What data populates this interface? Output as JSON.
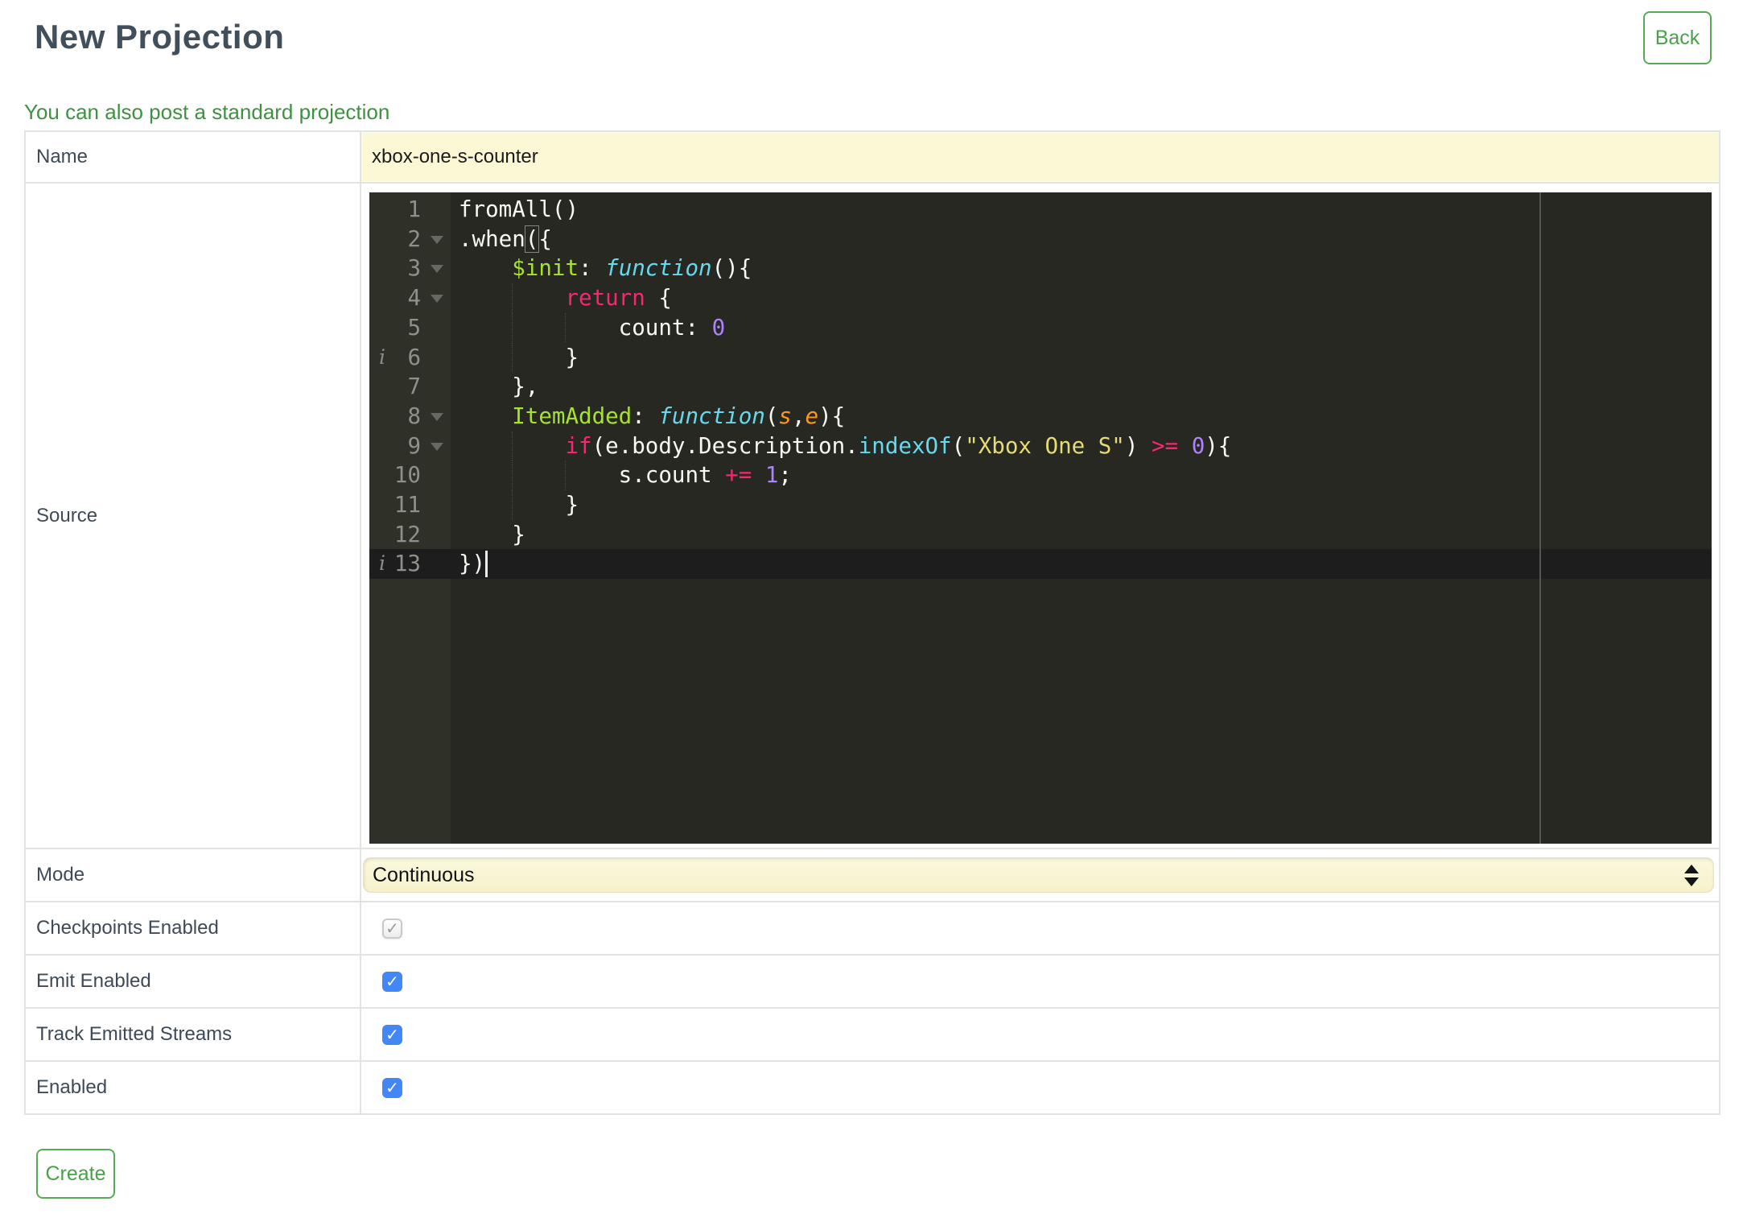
{
  "page": {
    "title": "New Projection"
  },
  "toolbar": {
    "back_label": "Back",
    "create_label": "Create"
  },
  "link": {
    "standard_projection": "You can also post a standard projection"
  },
  "icons": {
    "check_glyph": "✓",
    "info_glyph": "i"
  },
  "colors": {
    "accent_green": "#4aa14a",
    "link_green": "#3f9142",
    "title_slate": "#414e5b",
    "input_yellow": "#fcf8d5",
    "checkbox_blue": "#4287f5",
    "editor_bg": "#272822",
    "editor_gutter_bg": "#2f3129",
    "editor_active_line": "#1d1d1d"
  },
  "form": {
    "name": {
      "label": "Name",
      "value": "xbox-one-s-counter"
    },
    "source": {
      "label": "Source"
    },
    "mode": {
      "label": "Mode",
      "value": "Continuous"
    },
    "checkboxes": [
      {
        "label": "Checkpoints Enabled",
        "checked": true,
        "disabled": true
      },
      {
        "label": "Emit Enabled",
        "checked": true,
        "disabled": false
      },
      {
        "label": "Track Emitted Streams",
        "checked": true,
        "disabled": false
      },
      {
        "label": "Enabled",
        "checked": true,
        "disabled": false
      }
    ]
  },
  "editor": {
    "active_line": 13,
    "cursor": {
      "line": 13,
      "col": 2
    },
    "info_lines": [
      6,
      13
    ],
    "fold_lines": [
      2,
      3,
      4,
      8,
      9
    ],
    "colors": {
      "plain": "#f8f8f2",
      "keyword": "#f92672",
      "entity": "#a6e22e",
      "storage": "#66d9ef",
      "support": "#66d9ef",
      "string": "#e6db74",
      "number": "#ae81ff",
      "param": "#fd971f"
    },
    "lines": [
      {
        "num": 1,
        "tokens": [
          {
            "t": "fromAll()",
            "s": "plain"
          }
        ]
      },
      {
        "num": 2,
        "tokens": [
          {
            "t": ".when",
            "s": "plain"
          },
          {
            "t": "(",
            "s": "plain",
            "match": true
          },
          {
            "t": "{",
            "s": "plain"
          }
        ]
      },
      {
        "num": 3,
        "tokens": [
          {
            "t": "    ",
            "s": "plain"
          },
          {
            "t": "$init",
            "s": "entity"
          },
          {
            "t": ": ",
            "s": "plain"
          },
          {
            "t": "function",
            "s": "storage"
          },
          {
            "t": "(){",
            "s": "plain"
          }
        ]
      },
      {
        "num": 4,
        "tokens": [
          {
            "t": "        ",
            "s": "plain"
          },
          {
            "t": "return",
            "s": "keyword"
          },
          {
            "t": " {",
            "s": "plain"
          }
        ]
      },
      {
        "num": 5,
        "tokens": [
          {
            "t": "            count: ",
            "s": "plain"
          },
          {
            "t": "0",
            "s": "number"
          }
        ]
      },
      {
        "num": 6,
        "tokens": [
          {
            "t": "        }",
            "s": "plain"
          }
        ]
      },
      {
        "num": 7,
        "tokens": [
          {
            "t": "    },",
            "s": "plain"
          }
        ]
      },
      {
        "num": 8,
        "tokens": [
          {
            "t": "    ",
            "s": "plain"
          },
          {
            "t": "ItemAdded",
            "s": "entity"
          },
          {
            "t": ": ",
            "s": "plain"
          },
          {
            "t": "function",
            "s": "storage"
          },
          {
            "t": "(",
            "s": "plain"
          },
          {
            "t": "s",
            "s": "param"
          },
          {
            "t": ",",
            "s": "plain"
          },
          {
            "t": "e",
            "s": "param"
          },
          {
            "t": "){",
            "s": "plain"
          }
        ]
      },
      {
        "num": 9,
        "tokens": [
          {
            "t": "        ",
            "s": "plain"
          },
          {
            "t": "if",
            "s": "keyword"
          },
          {
            "t": "(e.body.Description.",
            "s": "plain"
          },
          {
            "t": "indexOf",
            "s": "support"
          },
          {
            "t": "(",
            "s": "plain"
          },
          {
            "t": "\"Xbox One S\"",
            "s": "string"
          },
          {
            "t": ") ",
            "s": "plain"
          },
          {
            "t": ">=",
            "s": "keyword"
          },
          {
            "t": " ",
            "s": "plain"
          },
          {
            "t": "0",
            "s": "number"
          },
          {
            "t": "){",
            "s": "plain"
          }
        ]
      },
      {
        "num": 10,
        "tokens": [
          {
            "t": "            s.count ",
            "s": "plain"
          },
          {
            "t": "+=",
            "s": "keyword"
          },
          {
            "t": " ",
            "s": "plain"
          },
          {
            "t": "1",
            "s": "number"
          },
          {
            "t": ";",
            "s": "plain"
          }
        ]
      },
      {
        "num": 11,
        "tokens": [
          {
            "t": "        }",
            "s": "plain"
          }
        ]
      },
      {
        "num": 12,
        "tokens": [
          {
            "t": "    }",
            "s": "plain"
          }
        ]
      },
      {
        "num": 13,
        "tokens": [
          {
            "t": "})",
            "s": "plain"
          }
        ]
      }
    ]
  }
}
